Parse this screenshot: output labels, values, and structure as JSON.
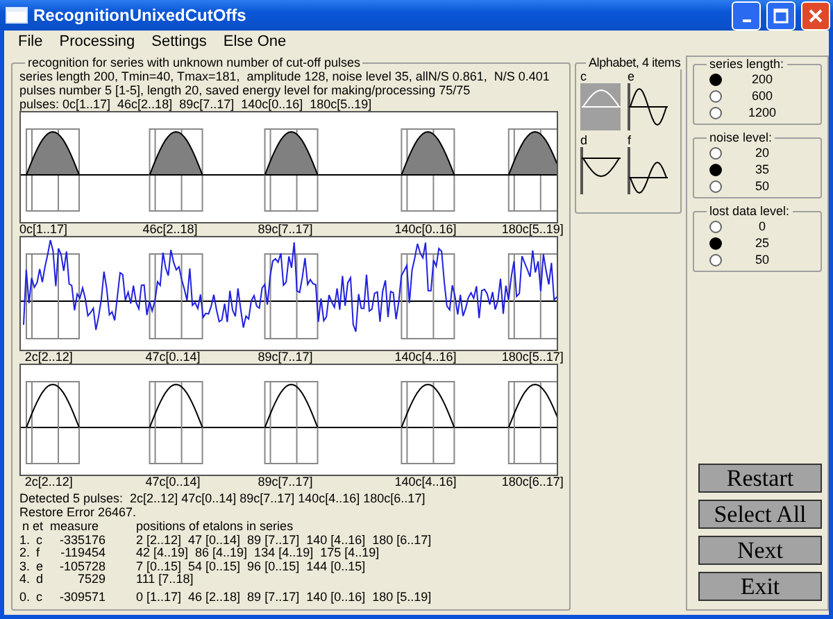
{
  "window": {
    "title": "RecognitionUnixedCutOffs"
  },
  "menu": [
    "File",
    "Processing",
    "Settings",
    "Else One"
  ],
  "recognition": {
    "title": "recognition for series with unknown number of cut-off pulses",
    "info_lines": [
      "series length 200, Tmin=40, Tmax=181,  amplitude 128, noise level 35, allN/S 0.861,  N/S 0.401",
      "pulses number 5 [1-5], length 20, saved energy level for making/processing 75/75",
      "pulses: 0c[1..17]  46c[2..18]  89c[7..17]  140c[0..16]  180c[5..19]"
    ],
    "plots": [
      {
        "kind": "filled-pulses",
        "labels": [
          "0c[1..17]",
          "46c[2..18]",
          "89c[7..17]",
          "140c[0..16]",
          "180c[5..19]"
        ]
      },
      {
        "kind": "noisy-signal",
        "labels": [
          "2c[2..12]",
          "47c[0..14]",
          "89c[7..17]",
          "140c[4..16]",
          "180c[5..17]"
        ]
      },
      {
        "kind": "outline-pulses",
        "labels": [
          "2c[2..12]",
          "47c[0..14]",
          "89c[7..17]",
          "140c[4..16]",
          "180c[6..17]"
        ]
      }
    ],
    "detected": "Detected 5 pulses:  2c[2..12] 47c[0..14] 89c[7..17] 140c[4..16] 180c[6..17]",
    "restore_error": "Restore Error 26467.",
    "etalons": {
      "header_measure": "n et  measure",
      "header_positions": "positions of etalons in series",
      "rows": [
        {
          "n": "1.",
          "et": "c",
          "measure": "-335176",
          "positions": "2 [2..12]  47 [0..14]  89 [7..17]  140 [4..16]  180 [6..17]"
        },
        {
          "n": "2.",
          "et": "f",
          "measure": "-119454",
          "positions": "42 [4..19]  86 [4..19]  134 [4..19]  175 [4..19]"
        },
        {
          "n": "3.",
          "et": "e",
          "measure": "-105728",
          "positions": "7 [0..15]  54 [0..15]  96 [0..15]  144 [0..15]"
        },
        {
          "n": "4.",
          "et": "d",
          "measure": "7529",
          "positions": "111 [7..18]"
        },
        {
          "n": "0.",
          "et": "c",
          "measure": "-309571",
          "positions": "0 [1..17]  46 [2..18]  89 [7..17]  140 [0..16]  180 [5..19]"
        }
      ]
    }
  },
  "alphabet": {
    "title": "Alphabet, 4 items",
    "items": [
      {
        "letter": "c",
        "kind": "arch",
        "selected": true
      },
      {
        "letter": "e",
        "kind": "sine",
        "selected": false
      },
      {
        "letter": "d",
        "kind": "trough",
        "selected": false
      },
      {
        "letter": "f",
        "kind": "neg-sine",
        "selected": false
      }
    ]
  },
  "options": [
    {
      "title": "series length:",
      "choices": [
        {
          "label": "200",
          "selected": true
        },
        {
          "label": "600",
          "selected": false
        },
        {
          "label": "1200",
          "selected": false
        }
      ]
    },
    {
      "title": "noise level:",
      "choices": [
        {
          "label": "20",
          "selected": false
        },
        {
          "label": "35",
          "selected": true
        },
        {
          "label": "50",
          "selected": false
        }
      ]
    },
    {
      "title": "lost data level:",
      "choices": [
        {
          "label": "0",
          "selected": false
        },
        {
          "label": "25",
          "selected": true
        },
        {
          "label": "50",
          "selected": false
        }
      ]
    }
  ],
  "buttons": [
    "Restart",
    "Select All",
    "Next",
    "Exit"
  ]
}
